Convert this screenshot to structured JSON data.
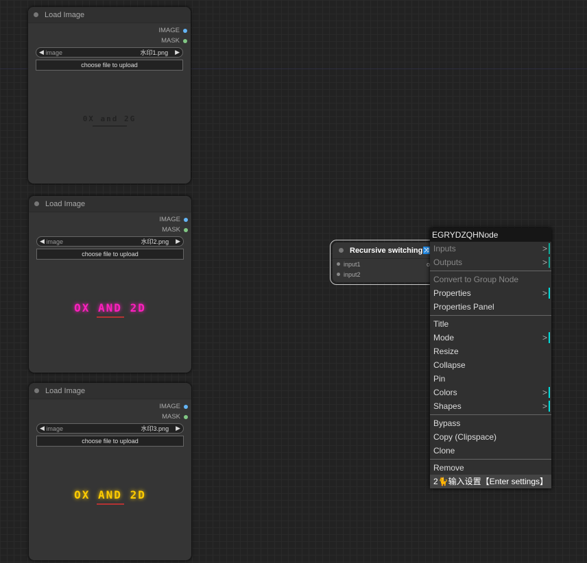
{
  "nodes": [
    {
      "title": "Load Image",
      "outputs": [
        "IMAGE",
        "MASK"
      ],
      "widget_label": "image",
      "widget_value": "水印1.png",
      "upload_label": "choose file to upload",
      "watermark": "0X and 2G",
      "watermark_color": "#222222"
    },
    {
      "title": "Load Image",
      "outputs": [
        "IMAGE",
        "MASK"
      ],
      "widget_label": "image",
      "widget_value": "水印2.png",
      "upload_label": "choose file to upload",
      "watermark": "OX AND 2D",
      "watermark_color": "#ff1fbf"
    },
    {
      "title": "Load Image",
      "outputs": [
        "IMAGE",
        "MASK"
      ],
      "widget_label": "image",
      "widget_value": "水印3.png",
      "upload_label": "choose file to upload",
      "watermark": "OX AND 2D",
      "watermark_color": "#ffcc00"
    }
  ],
  "recursive_node": {
    "title": "Recursive switching",
    "icon": "shuffle-icon",
    "inputs": [
      "input1",
      "input2"
    ],
    "output": "output"
  },
  "context_menu": {
    "title": "EGRYDZQHNode",
    "items": [
      {
        "label": "Inputs",
        "disabled": true,
        "submenu": true
      },
      {
        "label": "Outputs",
        "disabled": true,
        "submenu": true
      },
      {
        "sep": true
      },
      {
        "label": "Convert to Group Node",
        "disabled": true
      },
      {
        "label": "Properties",
        "submenu": true
      },
      {
        "label": "Properties Panel"
      },
      {
        "sep": true
      },
      {
        "label": "Title"
      },
      {
        "label": "Mode",
        "submenu": true
      },
      {
        "label": "Resize"
      },
      {
        "label": "Collapse"
      },
      {
        "label": "Pin"
      },
      {
        "label": "Colors",
        "submenu": true
      },
      {
        "label": "Shapes",
        "submenu": true
      },
      {
        "sep": true
      },
      {
        "label": "Bypass"
      },
      {
        "label": "Copy (Clipspace)"
      },
      {
        "label": "Clone"
      },
      {
        "sep": true
      },
      {
        "label": "Remove"
      },
      {
        "label": "2🐈输入设置【Enter settings】",
        "highlight": true
      }
    ]
  }
}
